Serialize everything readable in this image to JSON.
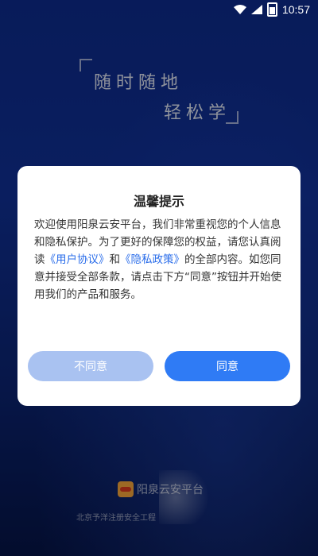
{
  "status_bar": {
    "time": "10:57",
    "icons": [
      "wifi-icon",
      "signal-icon",
      "battery-icon"
    ]
  },
  "splash": {
    "slogan_line1": "随时随地",
    "slogan_line2": "轻松学"
  },
  "dialog": {
    "title": "温馨提示",
    "body_part1": "欢迎使用阳泉云安平台，我们非常重视您的个人信息和隐私保护。为了更好的保障您的权益，请您认真阅读",
    "link_user_agreement": "《用户协议》",
    "body_and": "和",
    "link_privacy_policy": "《隐私政策》",
    "body_part2": "的全部内容。如您同意并接受全部条款，请点击下方“同意”按钮并开始使用我们的产品和服务。",
    "disagree_label": "不同意",
    "agree_label": "同意"
  },
  "footer": {
    "app_name": "阳泉云安平台",
    "company": "北京予洋注册安全工程"
  },
  "colors": {
    "background": "#0d2a8a",
    "primary_button": "#2f7bf5",
    "disabled_button": "#a9c2f1",
    "link": "#2a6dea"
  }
}
